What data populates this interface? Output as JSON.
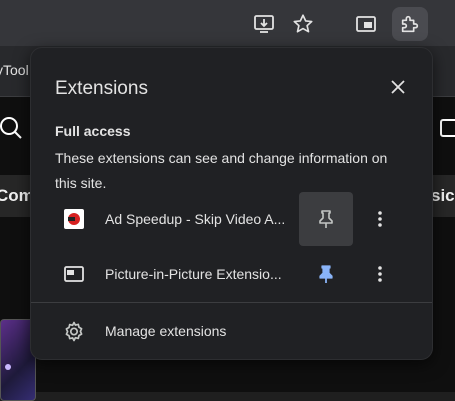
{
  "bookmarks_bar": {
    "partial_text": "yTool"
  },
  "background_page": {
    "strip_left_text": "Come",
    "strip_right_text": "sic"
  },
  "extensions_popup": {
    "title": "Extensions",
    "full_access": {
      "heading": "Full access",
      "description": "These extensions can see and change information on this site."
    },
    "extensions": [
      {
        "name": "Ad Speedup - Skip Video A...",
        "icon": "ad-speedup-icon",
        "pinned": false
      },
      {
        "name": "Picture-in-Picture Extensio...",
        "icon": "picture-in-picture-icon",
        "pinned": true
      }
    ],
    "manage_label": "Manage extensions"
  },
  "colors": {
    "accent_pin": "#8ab4f8",
    "popup_bg": "#202124",
    "toolbar_bg": "#35363a"
  }
}
